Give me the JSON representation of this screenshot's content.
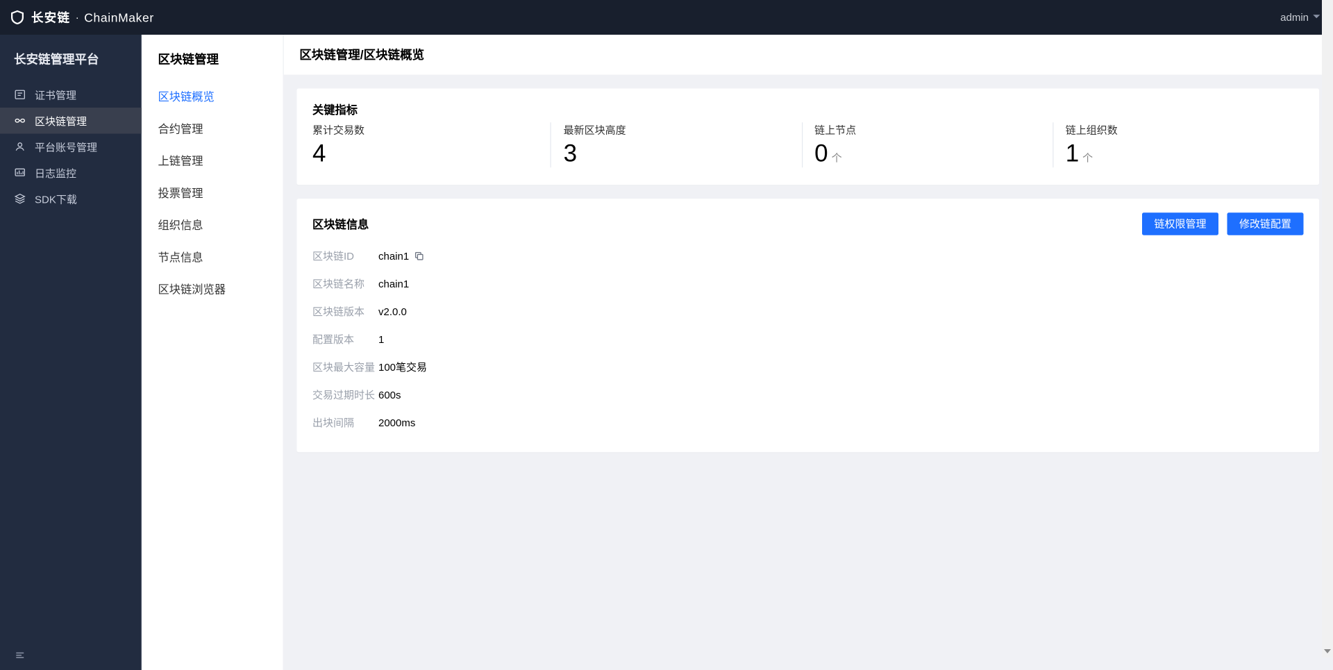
{
  "topbar": {
    "brand_cn": "长安链",
    "brand_sep": "·",
    "brand_en": "ChainMaker",
    "user": "admin"
  },
  "sidebar": {
    "platform_title": "长安链管理平台",
    "items": [
      {
        "label": "证书管理",
        "icon": "cert"
      },
      {
        "label": "区块链管理",
        "icon": "chain",
        "active": true
      },
      {
        "label": "平台账号管理",
        "icon": "user"
      },
      {
        "label": "日志监控",
        "icon": "monitor"
      },
      {
        "label": "SDK下载",
        "icon": "download"
      }
    ]
  },
  "sub_sidebar": {
    "title": "区块链管理",
    "items": [
      {
        "label": "区块链概览",
        "active": true
      },
      {
        "label": "合约管理"
      },
      {
        "label": "上链管理"
      },
      {
        "label": "投票管理"
      },
      {
        "label": "组织信息"
      },
      {
        "label": "节点信息"
      },
      {
        "label": "区块链浏览器"
      }
    ]
  },
  "breadcrumb": "区块链管理/区块链概览",
  "kpi": {
    "title": "关键指标",
    "cells": [
      {
        "label": "累计交易数",
        "value": "4",
        "unit": ""
      },
      {
        "label": "最新区块高度",
        "value": "3",
        "unit": ""
      },
      {
        "label": "链上节点",
        "value": "0",
        "unit": "个"
      },
      {
        "label": "链上组织数",
        "value": "1",
        "unit": "个"
      }
    ]
  },
  "info": {
    "title": "区块链信息",
    "btn_auth": "链权限管理",
    "btn_config": "修改链配置",
    "rows": [
      {
        "k": "区块链ID",
        "v": "chain1",
        "copy": true
      },
      {
        "k": "区块链名称",
        "v": "chain1"
      },
      {
        "k": "区块链版本",
        "v": "v2.0.0"
      },
      {
        "k": "配置版本",
        "v": "1"
      },
      {
        "k": "区块最大容量",
        "v": "100笔交易"
      },
      {
        "k": "交易过期时长",
        "v": "600s"
      },
      {
        "k": "出块间隔",
        "v": "2000ms"
      }
    ]
  }
}
